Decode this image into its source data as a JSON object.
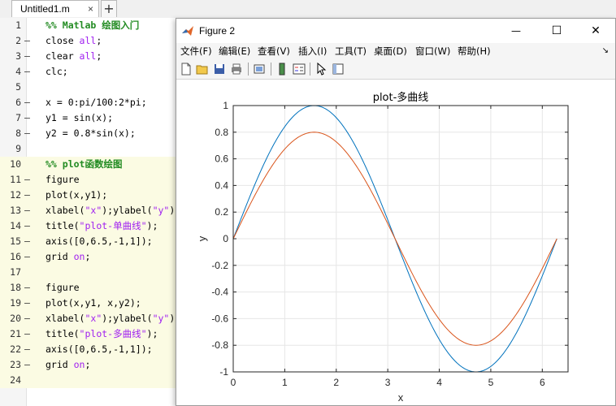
{
  "editor": {
    "tab_label": "Untitled1.m",
    "tab_close": "×",
    "tab_add": "+",
    "lines": [
      {
        "num": "1",
        "dash": "",
        "code": "%% Matlab 绘图入门",
        "type": "comment",
        "cell": false
      },
      {
        "num": "2",
        "dash": "—",
        "code": "close all;",
        "type": "kw",
        "cell": false
      },
      {
        "num": "3",
        "dash": "—",
        "code": "clear all;",
        "type": "kw",
        "cell": false
      },
      {
        "num": "4",
        "dash": "—",
        "code": "clc;",
        "type": "plain",
        "cell": false
      },
      {
        "num": "5",
        "dash": "",
        "code": "",
        "type": "plain",
        "cell": false
      },
      {
        "num": "6",
        "dash": "—",
        "code": "x = 0:pi/100:2*pi;",
        "type": "plain",
        "cell": false
      },
      {
        "num": "7",
        "dash": "—",
        "code": "y1 = sin(x);",
        "type": "plain",
        "cell": false
      },
      {
        "num": "8",
        "dash": "—",
        "code": "y2 = 0.8*sin(x);",
        "type": "plain",
        "cell": false
      },
      {
        "num": "9",
        "dash": "",
        "code": "",
        "type": "plain",
        "cell": false
      },
      {
        "num": "10",
        "dash": "",
        "code": "%% plot函数绘图",
        "type": "comment",
        "cell": true
      },
      {
        "num": "11",
        "dash": "—",
        "code": "figure",
        "type": "plain",
        "cell": true
      },
      {
        "num": "12",
        "dash": "—",
        "code": "plot(x,y1);",
        "type": "plain",
        "cell": true
      },
      {
        "num": "13",
        "dash": "—",
        "code": "xlabel(\"x\");ylabel(\"y\");",
        "type": "str",
        "cell": true
      },
      {
        "num": "14",
        "dash": "—",
        "code": "title(\"plot-单曲线\");",
        "type": "str",
        "cell": true
      },
      {
        "num": "15",
        "dash": "—",
        "code": "axis([0,6.5,-1,1]);",
        "type": "plain",
        "cell": true
      },
      {
        "num": "16",
        "dash": "—",
        "code": "grid on;",
        "type": "kw",
        "cell": true
      },
      {
        "num": "17",
        "dash": "",
        "code": "",
        "type": "plain",
        "cell": true
      },
      {
        "num": "18",
        "dash": "—",
        "code": "figure",
        "type": "plain",
        "cell": true
      },
      {
        "num": "19",
        "dash": "—",
        "code": "plot(x,y1, x,y2);",
        "type": "plain",
        "cell": true
      },
      {
        "num": "20",
        "dash": "—",
        "code": "xlabel(\"x\");ylabel(\"y\");",
        "type": "str",
        "cell": true
      },
      {
        "num": "21",
        "dash": "—",
        "code": "title(\"plot-多曲线\");",
        "type": "str",
        "cell": true
      },
      {
        "num": "22",
        "dash": "—",
        "code": "axis([0,6.5,-1,1]);",
        "type": "plain",
        "cell": true
      },
      {
        "num": "23",
        "dash": "—",
        "code": "grid on;",
        "type": "kw",
        "cell": true
      },
      {
        "num": "24",
        "dash": "",
        "code": "",
        "type": "plain",
        "cell": true
      }
    ]
  },
  "figure": {
    "title": "Figure 2",
    "minimize": "—",
    "maximize": "☐",
    "close": "✕",
    "menus": [
      "文件(F)",
      "编辑(E)",
      "查看(V)",
      "插入(I)",
      "工具(T)",
      "桌面(D)",
      "窗口(W)",
      "帮助(H)"
    ],
    "menu_overflow": "↘"
  },
  "chart_data": {
    "type": "line",
    "title": "plot-多曲线",
    "xlabel": "x",
    "ylabel": "y",
    "xlim": [
      0,
      6.5
    ],
    "ylim": [
      -1,
      1
    ],
    "grid": true,
    "x_ticks": [
      "0",
      "1",
      "2",
      "3",
      "4",
      "5",
      "6"
    ],
    "y_ticks": [
      "1",
      "0.8",
      "0.6",
      "0.4",
      "0.2",
      "0",
      "-0.2",
      "-0.4",
      "-0.6",
      "-0.8",
      "-1"
    ],
    "x_range": [
      0,
      6.2832
    ],
    "series": [
      {
        "expression": "sin(x)",
        "color": "#0072BD"
      },
      {
        "expression": "0.8*sin(x)",
        "color": "#D95319"
      }
    ]
  }
}
